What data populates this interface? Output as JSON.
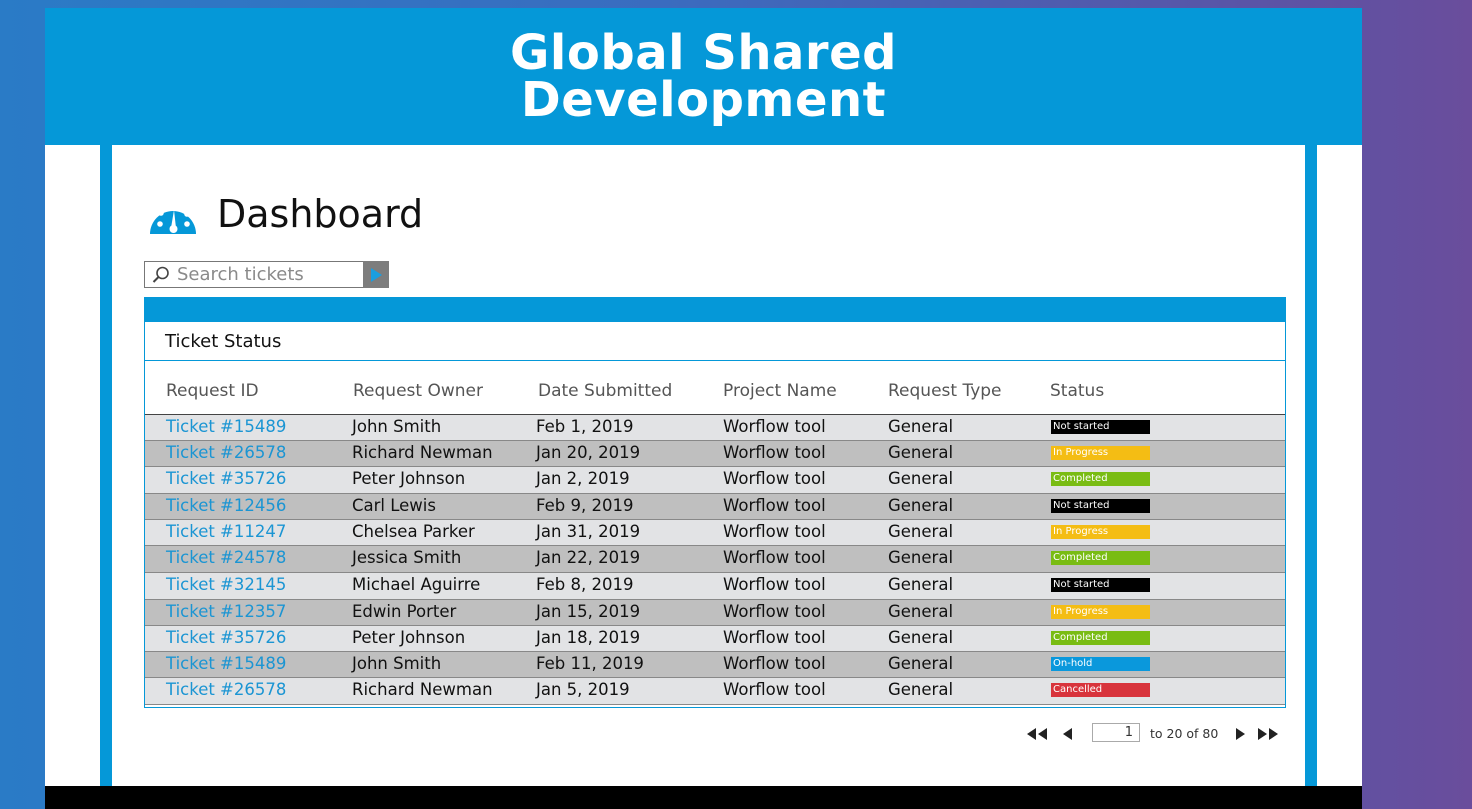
{
  "banner": {
    "title_line1": "Global Shared",
    "title_line2": "Development"
  },
  "dashboard": {
    "title": "Dashboard",
    "icon": "speedometer-icon"
  },
  "search": {
    "placeholder": "Search tickets",
    "value": ""
  },
  "panel": {
    "title": "Ticket Status"
  },
  "table": {
    "columns": [
      "Request ID",
      "Request Owner",
      "Date Submitted",
      "Project Name",
      "Request Type",
      "Status"
    ],
    "rows": [
      {
        "id": "Ticket #15489",
        "owner": "John Smith",
        "date": "Feb 1, 2019",
        "project": "Worflow tool",
        "type": "General",
        "status": "Not started"
      },
      {
        "id": "Ticket #26578",
        "owner": "Richard Newman",
        "date": "Jan 20, 2019",
        "project": "Worflow tool",
        "type": "General",
        "status": "In Progress"
      },
      {
        "id": "Ticket #35726",
        "owner": "Peter Johnson",
        "date": "Jan 2, 2019",
        "project": "Worflow tool",
        "type": "General",
        "status": "Completed"
      },
      {
        "id": "Ticket #12456",
        "owner": "Carl Lewis",
        "date": "Feb 9, 2019",
        "project": "Worflow tool",
        "type": "General",
        "status": "Not started"
      },
      {
        "id": "Ticket #11247",
        "owner": "Chelsea Parker",
        "date": "Jan 31, 2019",
        "project": "Worflow tool",
        "type": "General",
        "status": "In Progress"
      },
      {
        "id": "Ticket #24578",
        "owner": "Jessica Smith",
        "date": "Jan 22, 2019",
        "project": "Worflow tool",
        "type": "General",
        "status": "Completed"
      },
      {
        "id": "Ticket #32145",
        "owner": "Michael Aguirre",
        "date": "Feb 8, 2019",
        "project": "Worflow tool",
        "type": "General",
        "status": "Not started"
      },
      {
        "id": "Ticket #12357",
        "owner": "Edwin Porter",
        "date": "Jan 15, 2019",
        "project": "Worflow tool",
        "type": "General",
        "status": "In Progress"
      },
      {
        "id": "Ticket #35726",
        "owner": "Peter Johnson",
        "date": "Jan 18, 2019",
        "project": "Worflow tool",
        "type": "General",
        "status": "Completed"
      },
      {
        "id": "Ticket #15489",
        "owner": "John Smith",
        "date": "Feb 11, 2019",
        "project": "Worflow tool",
        "type": "General",
        "status": "On-hold"
      },
      {
        "id": "Ticket #26578",
        "owner": "Richard Newman",
        "date": "Jan 5, 2019",
        "project": "Worflow tool",
        "type": "General",
        "status": "Cancelled"
      }
    ]
  },
  "status_colors": {
    "Not started": {
      "bg": "#000000",
      "fg": "#ffffff"
    },
    "In Progress": {
      "bg": "#f4bd14",
      "fg": "#ffffff"
    },
    "Completed": {
      "bg": "#79bc13",
      "fg": "#ffffff"
    },
    "On-hold": {
      "bg": "#0a98dc",
      "fg": "#ffffff"
    },
    "Cancelled": {
      "bg": "#d8343c",
      "fg": "#ffffff"
    }
  },
  "pagination": {
    "current_page": "1",
    "range_text": "to 20 of 80"
  },
  "colors": {
    "brand": "#0598d8",
    "link": "#1b95d3",
    "footer": "#000000"
  }
}
